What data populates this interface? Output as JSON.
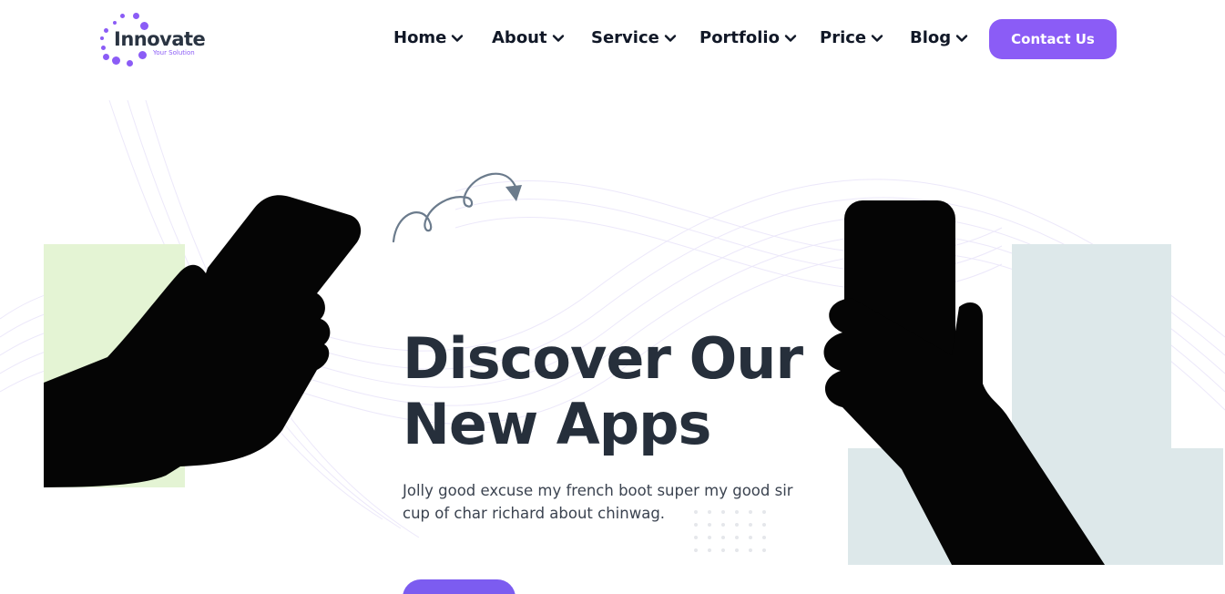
{
  "logo": {
    "name": "Innovate",
    "tagline": "Your Solution"
  },
  "nav": {
    "items": [
      {
        "label": "Home",
        "icon": "chevron-down-icon"
      },
      {
        "label": "About",
        "icon": "chevron-down-icon"
      },
      {
        "label": "Service",
        "icon": "chevron-down-icon"
      },
      {
        "label": "Portfolio",
        "icon": "chevron-down-icon"
      },
      {
        "label": "Price",
        "icon": "chevron-down-icon"
      },
      {
        "label": "Blog",
        "icon": "chevron-down-icon"
      }
    ],
    "contact_label": "Contact Us"
  },
  "hero": {
    "title_line1": "Discover Our",
    "title_line2": "New Apps",
    "text": "Jolly good excuse my french boot super my good sir cup of char richard about chinwag.",
    "button_label": ""
  },
  "colors": {
    "accent": "#8b5cf6",
    "heading": "#262f3b",
    "green_panel": "#e4f4d4",
    "grey_panel": "#dde8ea"
  }
}
